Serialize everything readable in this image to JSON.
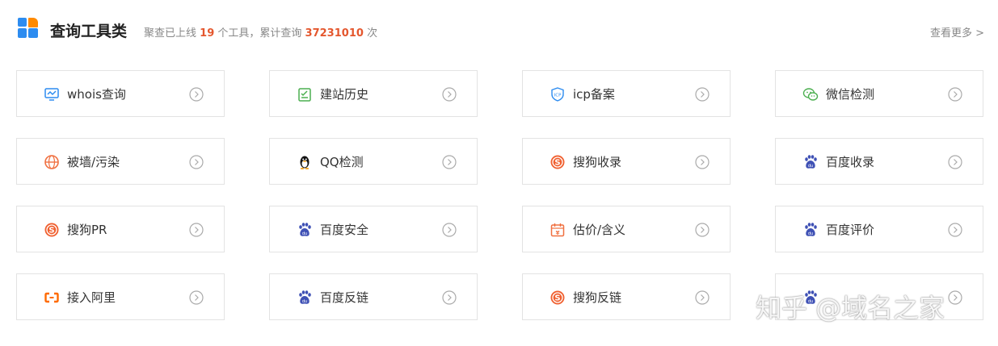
{
  "header": {
    "title": "查询工具类",
    "stats_prefix": "聚查已上线",
    "tool_count": "19",
    "stats_middle": "个工具，累计查询",
    "query_count": "37231010",
    "stats_suffix": "次",
    "more_label": "查看更多 >"
  },
  "tools": [
    {
      "label": "whois查询",
      "icon": "monitor-chart-icon"
    },
    {
      "label": "建站历史",
      "icon": "history-doc-icon"
    },
    {
      "label": "icp备案",
      "icon": "icp-shield-icon"
    },
    {
      "label": "微信检测",
      "icon": "wechat-icon"
    },
    {
      "label": "被墙/污染",
      "icon": "globe-block-icon"
    },
    {
      "label": "QQ检测",
      "icon": "qq-penguin-icon"
    },
    {
      "label": "搜狗收录",
      "icon": "sogou-icon"
    },
    {
      "label": "百度收录",
      "icon": "baidu-paw-icon"
    },
    {
      "label": "搜狗PR",
      "icon": "sogou-icon"
    },
    {
      "label": "百度安全",
      "icon": "baidu-paw-icon"
    },
    {
      "label": "估价/含义",
      "icon": "calendar-price-icon"
    },
    {
      "label": "百度评价",
      "icon": "baidu-paw-icon"
    },
    {
      "label": "接入阿里",
      "icon": "aliyun-icon"
    },
    {
      "label": "百度反链",
      "icon": "baidu-paw-icon"
    },
    {
      "label": "搜狗反链",
      "icon": "sogou-icon"
    },
    {
      "label": "",
      "icon": "baidu-paw-icon"
    }
  ],
  "watermark": "知乎 @域名之家",
  "colors": {
    "accent": "#e4572e",
    "blue": "#2d8cf0",
    "orange": "#ff8a00",
    "baidu": "#3f51b5",
    "green": "#4caf50"
  }
}
